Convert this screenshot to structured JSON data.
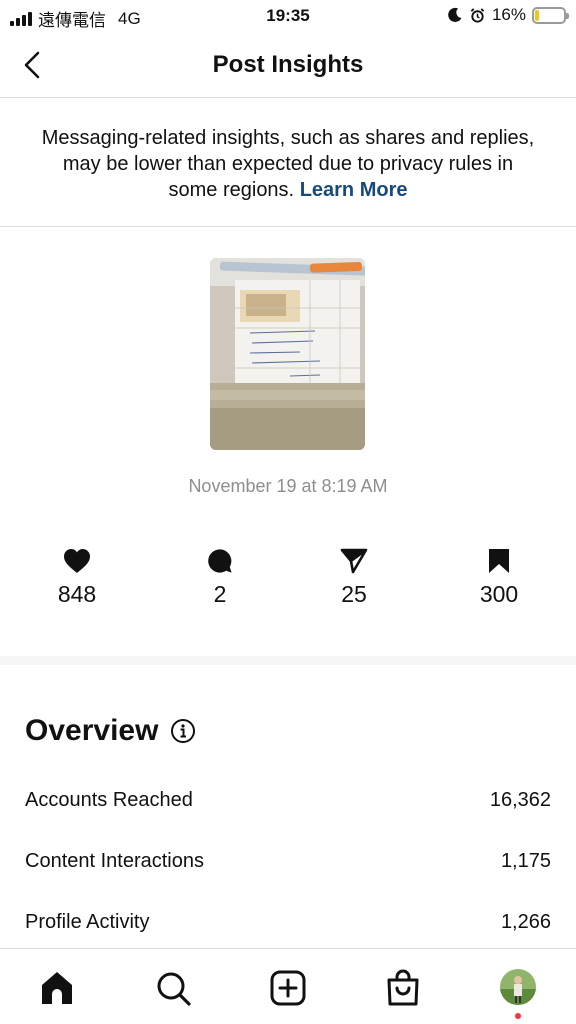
{
  "status_bar": {
    "carrier": "遠傳電信",
    "network": "4G",
    "time": "19:35",
    "battery": "16%",
    "battery_level": 0.16,
    "battery_color": "#f0c419"
  },
  "header": {
    "title": "Post Insights",
    "back_icon": "chevron-left-icon"
  },
  "notice": {
    "text": "Messaging-related insights, such as shares and replies, may be lower than expected due to privacy rules in some regions.",
    "link": "Learn More",
    "link_color": "#174a7c"
  },
  "post": {
    "date": "November 19 at 8:19 AM"
  },
  "stats": [
    {
      "icon": "heart-icon",
      "value": "848"
    },
    {
      "icon": "comment-icon",
      "value": "2"
    },
    {
      "icon": "share-icon",
      "value": "25"
    },
    {
      "icon": "bookmark-icon",
      "value": "300"
    }
  ],
  "overview": {
    "title": "Overview",
    "metrics": [
      {
        "label": "Accounts Reached",
        "value": "16,362"
      },
      {
        "label": "Content Interactions",
        "value": "1,175"
      },
      {
        "label": "Profile Activity",
        "value": "1,266"
      }
    ]
  },
  "tab_bar": {
    "tabs": [
      "home-icon",
      "search-icon",
      "create-icon",
      "shop-icon",
      "profile-avatar"
    ],
    "notification_color": "#ff3040"
  }
}
